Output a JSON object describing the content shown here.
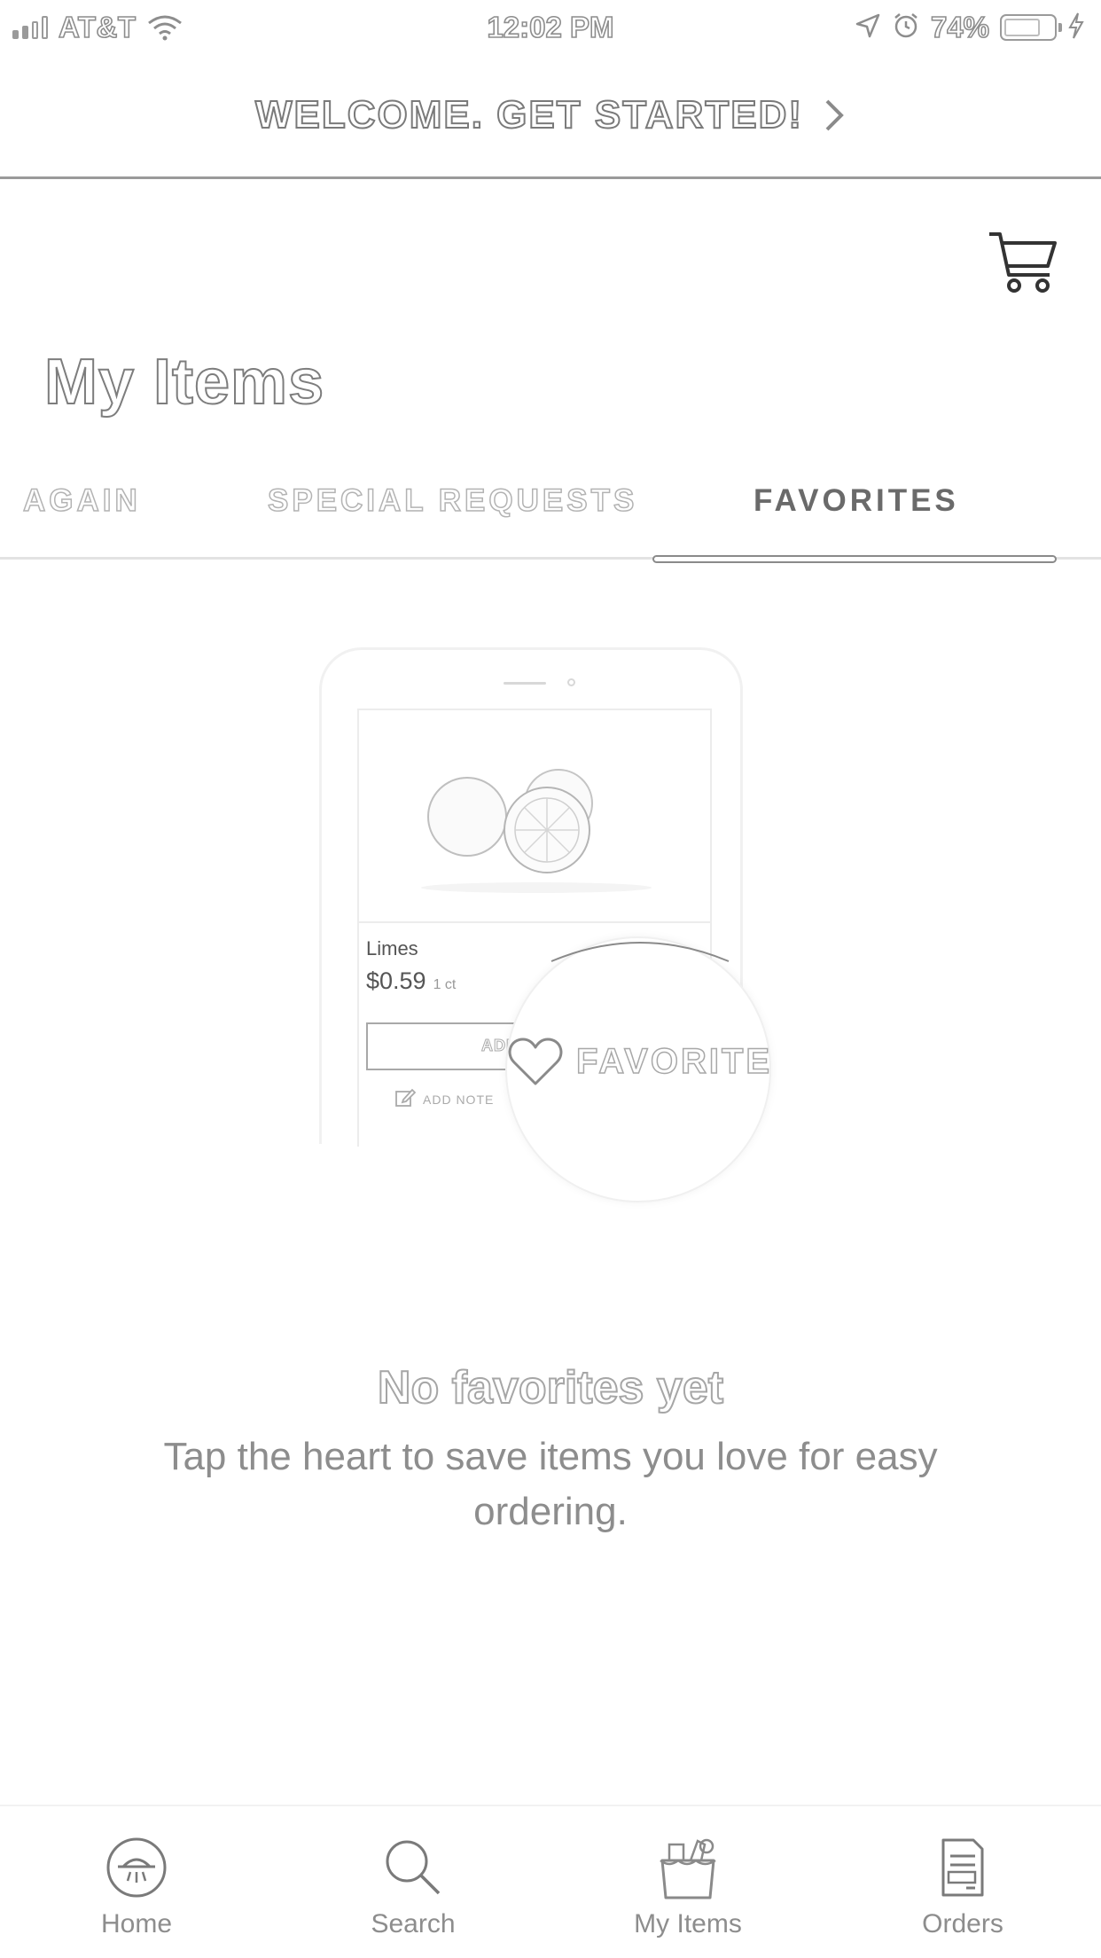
{
  "status_bar": {
    "carrier": "AT&T",
    "time": "12:02 PM",
    "battery_percent": "74%",
    "icons": [
      "signal-icon",
      "wifi-icon",
      "location-icon",
      "alarm-icon",
      "battery-icon",
      "charging-icon"
    ]
  },
  "banner": {
    "text": "WELCOME. GET STARTED!",
    "icon": "chevron-right-icon"
  },
  "header": {
    "title": "My Items",
    "cart_icon": "cart-icon"
  },
  "tabs": [
    {
      "label": "AGAIN",
      "active": false
    },
    {
      "label": "SPECIAL REQUESTS",
      "active": false
    },
    {
      "label": "FAVORITES",
      "active": true
    }
  ],
  "illustration": {
    "product_name": "Limes",
    "price": "$0.59",
    "unit": "1 ct",
    "add_label": "ADD",
    "add_note": "ADD NOTE",
    "favorite_label": "FAVORITE"
  },
  "empty_state": {
    "title": "No favorites yet",
    "description": "Tap the heart to save items you love for easy ordering."
  },
  "bottom_nav": [
    {
      "label": "Home",
      "icon": "home-icon"
    },
    {
      "label": "Search",
      "icon": "search-icon"
    },
    {
      "label": "My Items",
      "icon": "my-items-icon"
    },
    {
      "label": "Orders",
      "icon": "orders-icon"
    }
  ],
  "colors": {
    "text_primary": "#5a5a5a",
    "text_muted": "#8d8d8d",
    "divider": "#9a9a9a"
  }
}
